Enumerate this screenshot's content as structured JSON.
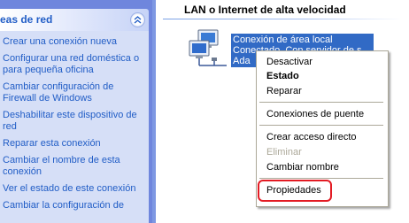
{
  "task_pane": {
    "title": "eas de red",
    "items": [
      {
        "label": "Crear una conexión nueva"
      },
      {
        "label": "Configurar una red doméstica o para pequeña oficina"
      },
      {
        "label": "Cambiar configuración de Firewall de Windows"
      },
      {
        "label": "Deshabilitar este dispositivo de red"
      },
      {
        "label": "Reparar esta conexión"
      },
      {
        "label": "Cambiar el nombre de esta conexión"
      },
      {
        "label": "Ver el estado de este conexión"
      },
      {
        "label": "Cambiar la configuración de"
      }
    ]
  },
  "main": {
    "section_title": "LAN o Internet de alta velocidad",
    "connection": {
      "line1": "Conexión de área local",
      "line2": "Conectado, Con servidor de s",
      "line3": "Ada"
    }
  },
  "context_menu": {
    "items": [
      {
        "label": "Desactivar",
        "bold": false,
        "disabled": false
      },
      {
        "label": "Estado",
        "bold": true,
        "disabled": false
      },
      {
        "label": "Reparar",
        "bold": false,
        "disabled": false
      },
      {
        "label": "Conexiones de puente",
        "bold": false,
        "disabled": false
      },
      {
        "label": "Crear acceso directo",
        "bold": false,
        "disabled": false
      },
      {
        "label": "Eliminar",
        "bold": false,
        "disabled": true
      },
      {
        "label": "Cambiar nombre",
        "bold": false,
        "disabled": false
      },
      {
        "label": "Propiedades",
        "bold": false,
        "disabled": false,
        "highlighted": true
      }
    ]
  },
  "icons": {
    "collapse": "chevron-up-double-icon",
    "network": "network-connection-icon"
  },
  "colors": {
    "pane_bg": "#d6dff7",
    "link": "#215dc6",
    "selection": "#316ac5",
    "highlight_ring": "#e31b23"
  }
}
